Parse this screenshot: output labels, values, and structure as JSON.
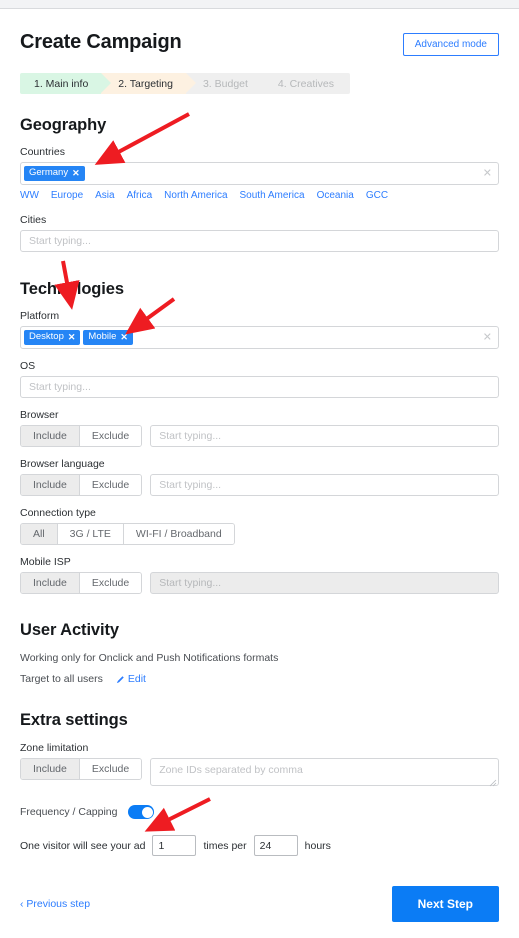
{
  "header": {
    "title": "Create Campaign",
    "advanced_mode_label": "Advanced mode"
  },
  "steps": [
    {
      "label": "1. Main info",
      "state": "done"
    },
    {
      "label": "2. Targeting",
      "state": "active"
    },
    {
      "label": "3. Budget",
      "state": "upcoming"
    },
    {
      "label": "4. Creatives",
      "state": "upcoming"
    }
  ],
  "geography": {
    "title": "Geography",
    "countries_label": "Countries",
    "countries_chips": [
      "Germany"
    ],
    "region_links": [
      "WW",
      "Europe",
      "Asia",
      "Africa",
      "North America",
      "South America",
      "Oceania",
      "GCC"
    ],
    "cities_label": "Cities",
    "cities_placeholder": "Start typing..."
  },
  "technologies": {
    "title": "Technologies",
    "platform_label": "Platform",
    "platform_chips": [
      "Desktop",
      "Mobile"
    ],
    "os_label": "OS",
    "os_placeholder": "Start typing...",
    "browser_label": "Browser",
    "browser_placeholder": "Start typing...",
    "browser_language_label": "Browser language",
    "browser_language_placeholder": "Start typing...",
    "connection_type_label": "Connection type",
    "connection_options": [
      "All",
      "3G / LTE",
      "WI-FI / Broadband"
    ],
    "connection_selected": "All",
    "mobile_isp_label": "Mobile ISP",
    "mobile_isp_placeholder": "Start typing...",
    "include_label": "Include",
    "exclude_label": "Exclude",
    "segment_selected": "Include"
  },
  "user_activity": {
    "title": "User Activity",
    "note": "Working only for Onclick and Push Notifications formats",
    "target_text": "Target to all users",
    "edit_label": "Edit"
  },
  "extra_settings": {
    "title": "Extra settings",
    "zone_limitation_label": "Zone limitation",
    "zone_include_label": "Include",
    "zone_exclude_label": "Exclude",
    "zone_selected": "Include",
    "zone_placeholder": "Zone IDs separated by comma",
    "frequency_label": "Frequency / Capping",
    "frequency_on": true,
    "freq_prefix": "One visitor will see your ad",
    "freq_times_value": "1",
    "freq_middle": "times per",
    "freq_hours_value": "24",
    "freq_suffix": "hours"
  },
  "footer": {
    "previous_label": "‹ Previous step",
    "next_label": "Next Step"
  },
  "colors": {
    "accent_blue": "#0b7cf5",
    "link_blue": "#2d7dff",
    "chip_blue": "#2585f5",
    "step_done": "#d9f6e4",
    "step_active": "#fdf1e1",
    "annotation_red": "#ee1c22"
  }
}
